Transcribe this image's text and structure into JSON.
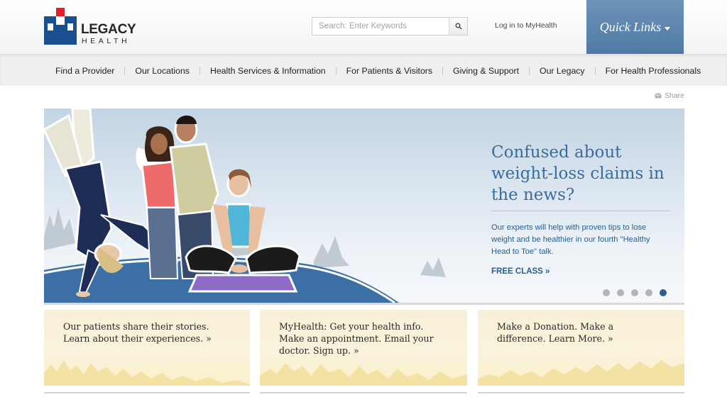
{
  "header": {
    "logo": {
      "wordmark": "LEGACY",
      "subtitle": "HEALTH",
      "brand_blue": "#1a4f8f",
      "brand_red": "#e01e2c"
    },
    "search": {
      "placeholder": "Search: Enter Keywords",
      "icon": "search-icon"
    },
    "login_label": "Log in to MyHealth",
    "quick_links_label": "Quick Links",
    "quick_links_color": "#5b84ad"
  },
  "nav": {
    "items": [
      {
        "label": "Find a Provider"
      },
      {
        "label": "Our Locations"
      },
      {
        "label": "Health Services & Information"
      },
      {
        "label": "For Patients & Visitors"
      },
      {
        "label": "Giving & Support"
      },
      {
        "label": "Our Legacy"
      },
      {
        "label": "For Health Professionals"
      }
    ]
  },
  "share_label": "Share",
  "hero": {
    "title": "Confused about weight-loss claims in the news?",
    "body": "Our experts will help with proven tips to lose weight and be healthier in our fourth \"Healthy Head to Toe\" talk.",
    "cta": "FREE CLASS »",
    "text_color": "#2b6396",
    "slides_total": 5,
    "active_slide": 5
  },
  "promos": [
    {
      "text_line1": "Our patients share their stories.",
      "text_line2": "Learn about their experiences. »",
      "text_line3": ""
    },
    {
      "text_line1": "MyHealth: Get your health info.",
      "text_line2": "Make an appointment. Email your",
      "text_line3": "doctor. Sign up. »"
    },
    {
      "text_line1": "Make a Donation. Make a",
      "text_line2": "difference. Learn More. »",
      "text_line3": ""
    }
  ]
}
